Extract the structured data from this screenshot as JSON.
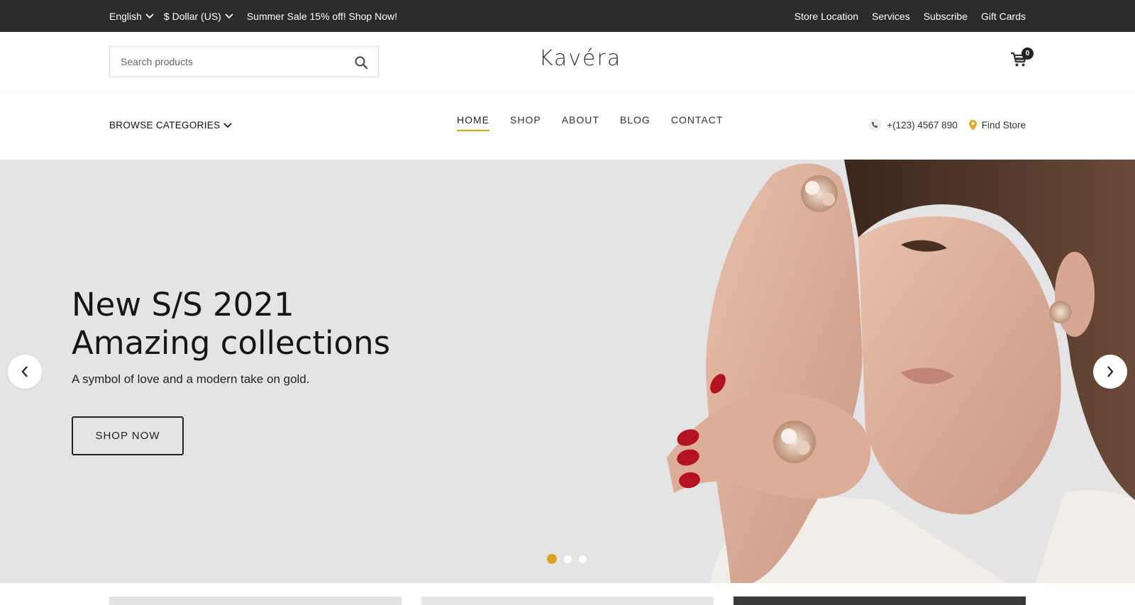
{
  "topbar": {
    "language": "English",
    "currency": "$ Dollar (US)",
    "promo": "Summer Sale 15% off! Shop Now!",
    "links": [
      "Store Location",
      "Services",
      "Subscribe",
      "Gift Cards"
    ]
  },
  "header": {
    "search_placeholder": "Search products",
    "logo": "Kavéra",
    "cart_count": "0"
  },
  "nav": {
    "browse": "BROWSE CATEGORIES",
    "items": [
      "HOME",
      "SHOP",
      "ABOUT",
      "BLOG",
      "CONTACT"
    ],
    "active_item": "HOME",
    "phone": "+(123) 4567 890",
    "find_store": "Find Store"
  },
  "hero": {
    "title_line1": "New S/S 2021",
    "title_line2": "Amazing collections",
    "subtitle": "A symbol of love and a modern take on gold.",
    "button": "SHOP NOW",
    "slide_count": 3,
    "active_slide": 1
  },
  "colors": {
    "accent": "#d9a520",
    "topbar_bg": "#2b2b2b",
    "hero_bg": "#e4e4e6"
  }
}
